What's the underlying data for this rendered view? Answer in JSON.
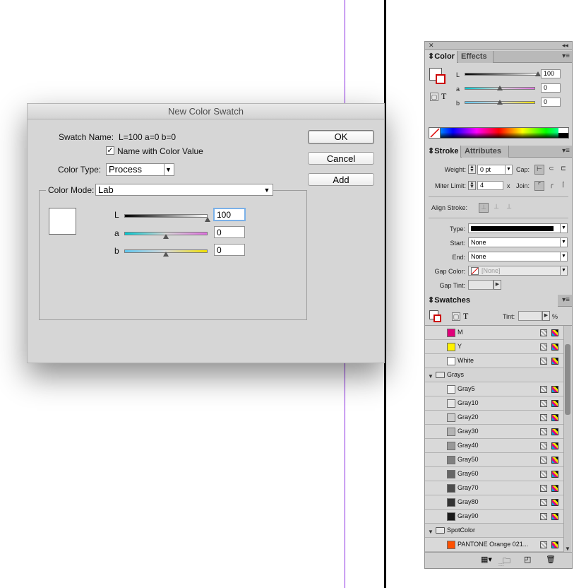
{
  "dialog": {
    "title": "New Color Swatch",
    "swatch_name_label": "Swatch Name:",
    "swatch_name_value": "L=100 a=0 b=0",
    "name_with_color_value_label": "Name with Color Value",
    "name_with_color_value_checked": true,
    "color_type_label": "Color Type:",
    "color_type_value": "Process",
    "color_mode_label": "Color Mode:",
    "color_mode_value": "Lab",
    "buttons": {
      "ok": "OK",
      "cancel": "Cancel",
      "add": "Add"
    },
    "sliders": [
      {
        "label": "L",
        "value": "100",
        "level": 1.0
      },
      {
        "label": "a",
        "value": "0",
        "level": 0.5
      },
      {
        "label": "b",
        "value": "0",
        "level": 0.5
      }
    ],
    "preview_color": "#ffffff"
  },
  "color_panel": {
    "tabs": [
      "Color",
      "Effects"
    ],
    "sliders": [
      {
        "label": "L",
        "value": "100",
        "level": 1.0
      },
      {
        "label": "a",
        "value": "0",
        "level": 0.5
      },
      {
        "label": "b",
        "value": "0",
        "level": 0.5
      }
    ],
    "text_toggle": "T"
  },
  "stroke_panel": {
    "tabs": [
      "Stroke",
      "Attributes"
    ],
    "weight_label": "Weight:",
    "weight_value": "0 pt",
    "cap_label": "Cap:",
    "miter_label": "Miter Limit:",
    "miter_value": "4",
    "miter_x": "x",
    "join_label": "Join:",
    "align_label": "Align Stroke:",
    "type_label": "Type:",
    "start_label": "Start:",
    "start_value": "None",
    "end_label": "End:",
    "end_value": "None",
    "gap_color_label": "Gap Color:",
    "gap_color_value": "[None]",
    "gap_tint_label": "Gap Tint:"
  },
  "swatches_panel": {
    "title": "Swatches",
    "tint_label": "Tint:",
    "tint_unit": "%",
    "text_toggle": "T",
    "rows": [
      {
        "kind": "swatch",
        "name": "M",
        "color": "#e0007a"
      },
      {
        "kind": "swatch",
        "name": "Y",
        "color": "#fff200"
      },
      {
        "kind": "swatch",
        "name": "White",
        "color": "#ffffff"
      },
      {
        "kind": "folder",
        "name": "Grays"
      },
      {
        "kind": "swatch",
        "name": "Gray5",
        "color": "#f2f2f2"
      },
      {
        "kind": "swatch",
        "name": "Gray10",
        "color": "#e6e6e6"
      },
      {
        "kind": "swatch",
        "name": "Gray20",
        "color": "#cccccc"
      },
      {
        "kind": "swatch",
        "name": "Gray30",
        "color": "#b3b3b3"
      },
      {
        "kind": "swatch",
        "name": "Gray40",
        "color": "#999999"
      },
      {
        "kind": "swatch",
        "name": "Gray50",
        "color": "#808080"
      },
      {
        "kind": "swatch",
        "name": "Gray60",
        "color": "#666666"
      },
      {
        "kind": "swatch",
        "name": "Gray70",
        "color": "#4d4d4d"
      },
      {
        "kind": "swatch",
        "name": "Gray80",
        "color": "#333333"
      },
      {
        "kind": "swatch",
        "name": "Gray90",
        "color": "#1a1a1a"
      },
      {
        "kind": "folder",
        "name": "SpotColor"
      },
      {
        "kind": "swatch",
        "name": "PANTONE Orange 021...",
        "color": "#fe5000"
      }
    ]
  },
  "colors": {
    "guide": "#8a2be2",
    "focus": "#7ab0e8",
    "orange": "#fe5000"
  }
}
